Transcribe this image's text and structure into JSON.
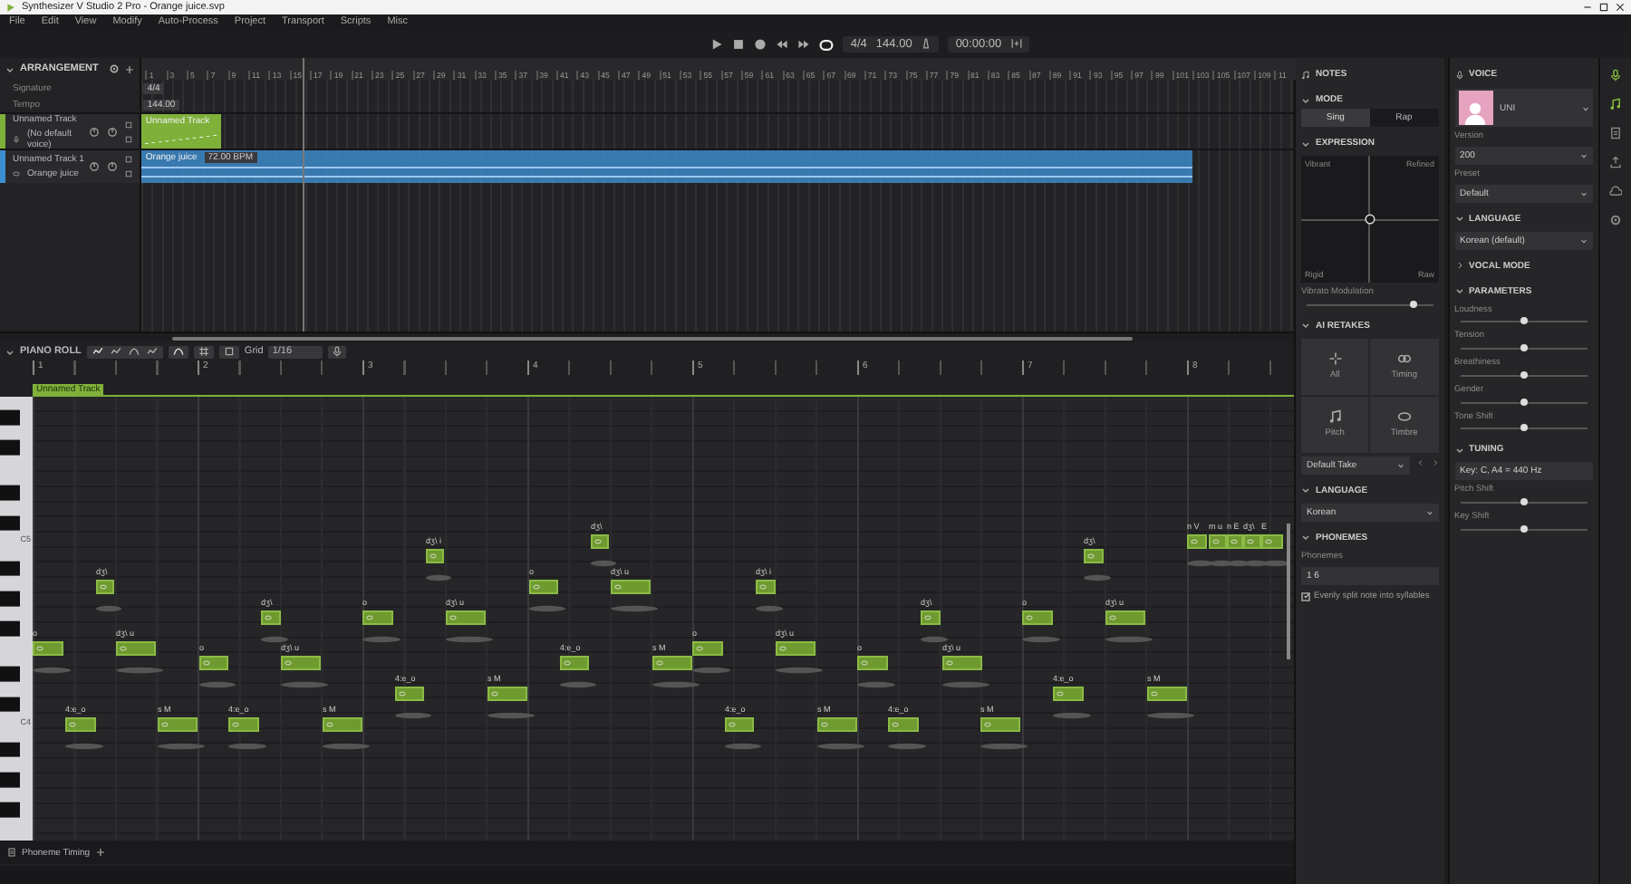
{
  "window": {
    "title": "Synthesizer V Studio 2 Pro - Orange juice.svp"
  },
  "menu": [
    "File",
    "Edit",
    "View",
    "Modify",
    "Auto-Process",
    "Project",
    "Transport",
    "Scripts",
    "Misc"
  ],
  "transport": {
    "signature": "4/4",
    "tempo": "144.00",
    "time": "00:00:00",
    "loop": true
  },
  "arrangement": {
    "title": "ARRANGEMENT",
    "ruler": [
      "1",
      "3",
      "5",
      "7",
      "9",
      "11",
      "13",
      "15",
      "17",
      "19",
      "21",
      "23",
      "25",
      "27",
      "29",
      "31",
      "33",
      "35",
      "37",
      "39",
      "41",
      "43",
      "45",
      "47",
      "49",
      "51",
      "53",
      "55",
      "57",
      "59",
      "61",
      "63",
      "65",
      "67",
      "69",
      "71",
      "73",
      "75",
      "77",
      "79",
      "81",
      "83",
      "85",
      "87",
      "89",
      "91",
      "93",
      "95",
      "97",
      "99",
      "101",
      "103",
      "105",
      "107",
      "109",
      "11"
    ],
    "signature": {
      "label": "Signature",
      "value": "4/4"
    },
    "tempo": {
      "label": "Tempo",
      "value": "144.00"
    },
    "tracks": [
      {
        "name": "Unnamed Track",
        "voice": "(No default voice)",
        "color": "#7fb03a",
        "clip": {
          "title": "Unnamed Track",
          "kind": "notes"
        }
      },
      {
        "name": "Unnamed Track 1",
        "voice": "Orange juice",
        "color": "#3d8fd1",
        "clip": {
          "title": "Orange juice",
          "tempo": "72.00 BPM",
          "kind": "audio"
        }
      }
    ]
  },
  "piano_roll": {
    "title": "PIANO ROLL",
    "grid_label": "Grid",
    "grid_value": "1/16",
    "bars": [
      "1",
      "2",
      "3",
      "4",
      "5",
      "6",
      "7",
      "8"
    ],
    "track_label": "Unnamed Track",
    "key_labels": [
      "C5",
      "C4"
    ],
    "notes": [
      {
        "phoneme": "o"
      },
      {
        "phoneme": "4:e_o"
      },
      {
        "phoneme": "dʒ\\"
      },
      {
        "phoneme": "dʒ\\ u"
      },
      {
        "phoneme": "s M"
      },
      {
        "phoneme": "o"
      },
      {
        "phoneme": "4:e_o"
      },
      {
        "phoneme": "dʒ\\"
      },
      {
        "phoneme": "dʒ\\ u"
      },
      {
        "phoneme": "s M"
      },
      {
        "phoneme": "o"
      },
      {
        "phoneme": "4:e_o"
      },
      {
        "phoneme": "dʒ\\ i"
      },
      {
        "phoneme": "dʒ\\ u"
      },
      {
        "phoneme": "s M"
      },
      {
        "phoneme": "o"
      },
      {
        "phoneme": "4:e_o"
      },
      {
        "phoneme": "dʒ\\"
      },
      {
        "phoneme": "dʒ\\ u"
      },
      {
        "phoneme": "s M"
      },
      {
        "phoneme": "o"
      },
      {
        "phoneme": "4:e_o"
      },
      {
        "phoneme": "dʒ\\ i"
      },
      {
        "phoneme": "dʒ\\ u"
      },
      {
        "phoneme": "s M"
      },
      {
        "phoneme": "o"
      },
      {
        "phoneme": "4:e_o"
      },
      {
        "phoneme": "dʒ\\"
      },
      {
        "phoneme": "dʒ\\ u"
      },
      {
        "phoneme": "s M"
      },
      {
        "phoneme": "o"
      },
      {
        "phoneme": "4:e_o"
      },
      {
        "phoneme": "dʒ\\"
      },
      {
        "phoneme": "dʒ\\ u"
      },
      {
        "phoneme": "s M"
      },
      {
        "phoneme": "n V"
      },
      {
        "phoneme": "m u"
      },
      {
        "phoneme": "n E"
      },
      {
        "phoneme": "dʒ\\"
      },
      {
        "phoneme": "E"
      }
    ],
    "bottom_tab": "Phoneme Timing"
  },
  "notes_panel": {
    "title": "NOTES",
    "mode_title": "MODE",
    "modes": [
      {
        "label": "Sing",
        "selected": true
      },
      {
        "label": "Rap",
        "selected": false
      }
    ],
    "expression_title": "EXPRESSION",
    "corners": [
      "Vibrant",
      "Refined",
      "Rigid",
      "Raw"
    ],
    "vibrato": {
      "label": "Vibrato Modulation",
      "level": 0.85
    },
    "retakes_title": "AI RETAKES",
    "retakes": [
      {
        "label": "All",
        "kind": "all"
      },
      {
        "label": "Timing",
        "kind": "timing"
      },
      {
        "label": "Pitch",
        "kind": "pitch"
      },
      {
        "label": "Timbre",
        "kind": "timbre"
      }
    ],
    "take": "Default Take",
    "language_title": "LANGUAGE",
    "language": "Korean",
    "phonemes_title": "PHONEMES",
    "phonemes_label": "Phonemes",
    "phonemes_value": "1 6",
    "split": {
      "label": "Evenly split note into syllables",
      "checked": true
    }
  },
  "voice_panel": {
    "title": "VOICE",
    "voice_name": "UNI",
    "version_label": "Version",
    "version": "200",
    "preset_label": "Preset",
    "preset": "Default",
    "language_title": "LANGUAGE",
    "language": "Korean (default)",
    "vocal_mode_title": "VOCAL MODE",
    "parameters_title": "PARAMETERS",
    "parameters": [
      {
        "label": "Loudness",
        "level": 0.5
      },
      {
        "label": "Tension",
        "level": 0.5
      },
      {
        "label": "Breathiness",
        "level": 0.5
      },
      {
        "label": "Gender",
        "level": 0.5
      },
      {
        "label": "Tone Shift",
        "level": 0.5
      }
    ],
    "tuning_title": "TUNING",
    "tuning": "Key: C, A4 = 440 Hz",
    "tuning_params": [
      {
        "label": "Pitch Shift",
        "level": 0.5
      },
      {
        "label": "Key Shift",
        "level": 0.5
      }
    ]
  },
  "side_strip": [
    {
      "kind": "mic",
      "selected": true
    },
    {
      "kind": "note",
      "selected": true
    },
    {
      "kind": "doc",
      "selected": false
    },
    {
      "kind": "upload",
      "selected": false
    },
    {
      "kind": "cloud",
      "selected": false
    },
    {
      "kind": "gear",
      "selected": false
    }
  ]
}
